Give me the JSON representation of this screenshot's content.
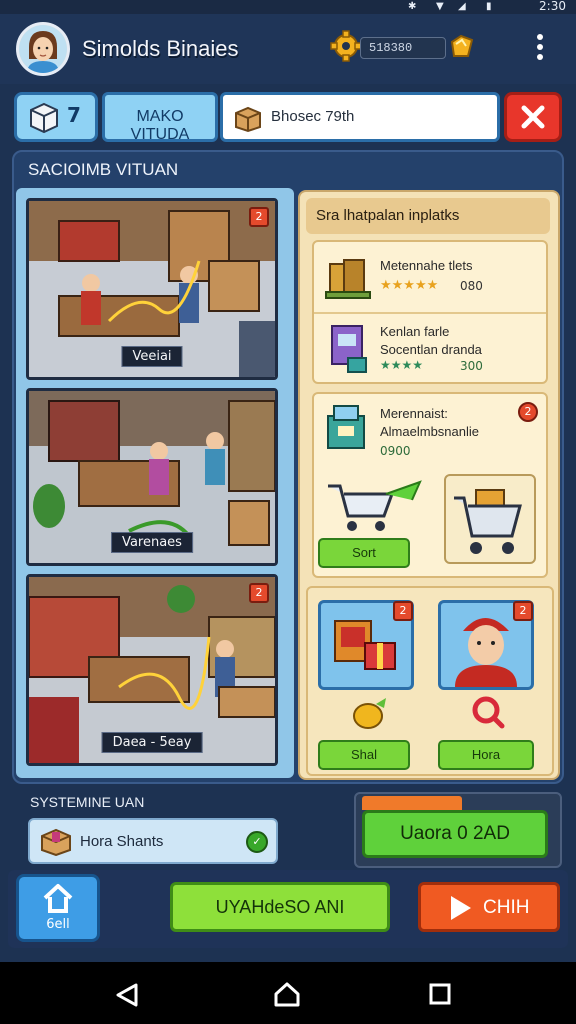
{
  "status_bar": {
    "time": "2:30"
  },
  "header": {
    "title": "Simolds Binaies",
    "currency_value": "518380"
  },
  "toolbar": {
    "cube_count": "7",
    "make_label": "MAKO VITUDA",
    "search_value": "Bhosec 79th"
  },
  "panel": {
    "title": "SACIOIMB VITUAN",
    "scenes": [
      {
        "label": "Veeiai",
        "badge": "2"
      },
      {
        "label": "Varenaes",
        "badge": ""
      },
      {
        "label": "Daea - 5eay",
        "badge": "2"
      }
    ],
    "right_header": "Sra lhatpalan inplatks",
    "items": [
      {
        "title": "Metennahe tlets",
        "price": "080",
        "stars": 5
      },
      {
        "title": "Kenlan farle",
        "subtitle": "Socentlan dranda",
        "price": "300",
        "stars": 4
      }
    ],
    "feature": {
      "title": "Merennaist:",
      "subtitle": "Almaelmbsnanlie",
      "price": "0900",
      "badge": "2",
      "button": "Sort"
    },
    "bottom_cards": [
      {
        "badge": "2",
        "button": "Shal"
      },
      {
        "badge": "2",
        "button": "Hora"
      }
    ]
  },
  "bottom": {
    "systems_label": "SYSTEMINE UAN",
    "hora_text": "Hora Shants",
    "upgrade_label": "Uaora 0 2AD",
    "home_label": "6ell",
    "wide_button": "UYAHdeSO ANI",
    "play_label": "CHIH"
  },
  "colors": {
    "accent_green": "#7ad63a",
    "accent_red": "#e8362b",
    "accent_orange": "#f05a22",
    "panel_blue": "#24416b",
    "card_cream": "#fdf2d3"
  }
}
